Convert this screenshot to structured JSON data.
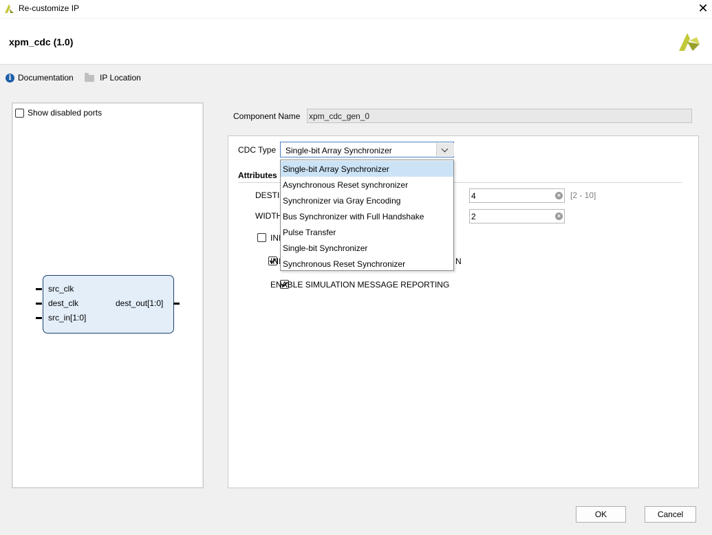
{
  "window": {
    "title": "Re-customize IP",
    "close_glyph": "✕"
  },
  "header": {
    "ip_name": "xpm_cdc (1.0)"
  },
  "links": {
    "documentation": "Documentation",
    "ip_location": "IP Location"
  },
  "left_panel": {
    "show_disabled_ports": "Show disabled ports",
    "ports_in": [
      "src_clk",
      "dest_clk",
      "src_in[1:0]"
    ],
    "port_out": "dest_out[1:0]"
  },
  "component": {
    "label": "Component Name",
    "value": "xpm_cdc_gen_0"
  },
  "cdc_type": {
    "label": "CDC Type",
    "selected": "Single-bit Array Synchronizer",
    "options": [
      "Single-bit Array Synchronizer",
      "Asynchronous Reset synchronizer",
      "Synchronizer via Gray Encoding",
      "Bus Synchronizer with Full Handshake",
      "Pulse Transfer",
      "Single-bit Synchronizer",
      "Synchronous Reset Synchronizer"
    ]
  },
  "attributes": {
    "heading": "Attributes",
    "dest_sync_ff": {
      "label_visible": "DESTI",
      "value": "4",
      "range": "[2 - 10]"
    },
    "width": {
      "label_visible": "WIDTH",
      "value": "2"
    },
    "init_sync_ff": {
      "label_visible": "INI"
    },
    "sim_assert_chk": {
      "label_visible_left": "INI",
      "label_visible_right": "N"
    },
    "sim_msg": {
      "label": "ENABLE SIMULATION MESSAGE REPORTING"
    }
  },
  "footer": {
    "ok": "OK",
    "cancel": "Cancel"
  },
  "colors": {
    "accent": "#4a7fc1",
    "symbol_fill": "#e3eef9",
    "symbol_border": "#1f3d70",
    "logo": "#c3c93a"
  }
}
